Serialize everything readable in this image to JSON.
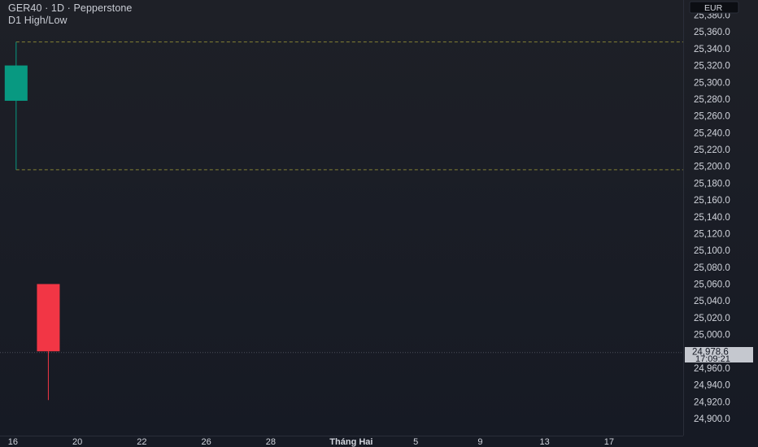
{
  "header": {
    "symbol_line": "GER40 · 1D · Pepperstone",
    "indicator_line": "D1 High/Low"
  },
  "price_scale": {
    "currency": "EUR",
    "current_price_label": "24,978.6",
    "countdown_label": "17:09:21"
  },
  "chart_data": {
    "type": "candlestick",
    "symbol": "GER40",
    "timeframe": "1D",
    "broker": "Pepperstone",
    "currency": "EUR",
    "ylim": [
      24885,
      25385
    ],
    "y_ticks": [
      24900,
      24920,
      24940,
      24960,
      24980,
      25000,
      25020,
      25040,
      25060,
      25080,
      25100,
      25120,
      25140,
      25160,
      25180,
      25200,
      25220,
      25240,
      25260,
      25280,
      25300,
      25320,
      25340,
      25360,
      25380
    ],
    "y_tick_labels": [
      "24,900.0",
      "24,920.0",
      "24,940.0",
      "24,960.0",
      "24,980.0",
      "25,000.0",
      "25,020.0",
      "25,040.0",
      "25,060.0",
      "25,080.0",
      "25,100.0",
      "25,120.0",
      "25,140.0",
      "25,160.0",
      "25,180.0",
      "25,200.0",
      "25,220.0",
      "25,240.0",
      "25,260.0",
      "25,280.0",
      "25,300.0",
      "25,320.0",
      "25,340.0",
      "25,360.0",
      "25,380.0"
    ],
    "x_ticks": [
      16,
      20,
      22,
      26,
      28,
      32,
      37,
      41,
      45,
      49,
      53
    ],
    "x_tick_labels": [
      "16",
      "20",
      "22",
      "26",
      "28",
      "Tháng Hai",
      "5",
      "9",
      "13",
      "17"
    ],
    "x_tick_days": [
      16,
      20,
      24,
      28,
      32,
      37,
      41,
      45,
      49,
      53
    ],
    "x_range": [
      15.2,
      57.6
    ],
    "candles": [
      {
        "day": 16.2,
        "open": 25278,
        "high": 25348,
        "low": 25196,
        "close": 25320
      },
      {
        "day": 18.2,
        "open": 25060,
        "high": 25060,
        "low": 24922,
        "close": 24980
      }
    ],
    "d1_high_low": {
      "high": 25348,
      "low": 25196
    },
    "current_price": 24978.6,
    "colors": {
      "up": "#089981",
      "down": "#f23645",
      "grid_text": "#d1d4dc",
      "level_line": "#a8a23a",
      "price_line": "#5a5d66"
    }
  }
}
